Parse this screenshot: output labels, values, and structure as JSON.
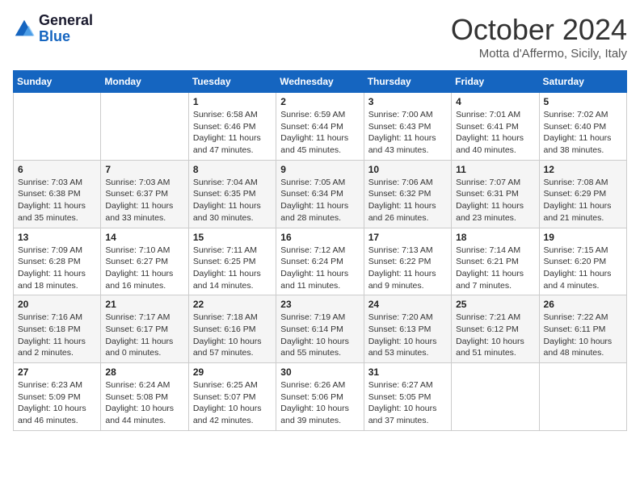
{
  "header": {
    "logo_general": "General",
    "logo_blue": "Blue",
    "month": "October 2024",
    "location": "Motta d'Affermo, Sicily, Italy"
  },
  "days_of_week": [
    "Sunday",
    "Monday",
    "Tuesday",
    "Wednesday",
    "Thursday",
    "Friday",
    "Saturday"
  ],
  "weeks": [
    [
      {
        "day": "",
        "sunrise": "",
        "sunset": "",
        "daylight": ""
      },
      {
        "day": "",
        "sunrise": "",
        "sunset": "",
        "daylight": ""
      },
      {
        "day": "1",
        "sunrise": "Sunrise: 6:58 AM",
        "sunset": "Sunset: 6:46 PM",
        "daylight": "Daylight: 11 hours and 47 minutes."
      },
      {
        "day": "2",
        "sunrise": "Sunrise: 6:59 AM",
        "sunset": "Sunset: 6:44 PM",
        "daylight": "Daylight: 11 hours and 45 minutes."
      },
      {
        "day": "3",
        "sunrise": "Sunrise: 7:00 AM",
        "sunset": "Sunset: 6:43 PM",
        "daylight": "Daylight: 11 hours and 43 minutes."
      },
      {
        "day": "4",
        "sunrise": "Sunrise: 7:01 AM",
        "sunset": "Sunset: 6:41 PM",
        "daylight": "Daylight: 11 hours and 40 minutes."
      },
      {
        "day": "5",
        "sunrise": "Sunrise: 7:02 AM",
        "sunset": "Sunset: 6:40 PM",
        "daylight": "Daylight: 11 hours and 38 minutes."
      }
    ],
    [
      {
        "day": "6",
        "sunrise": "Sunrise: 7:03 AM",
        "sunset": "Sunset: 6:38 PM",
        "daylight": "Daylight: 11 hours and 35 minutes."
      },
      {
        "day": "7",
        "sunrise": "Sunrise: 7:03 AM",
        "sunset": "Sunset: 6:37 PM",
        "daylight": "Daylight: 11 hours and 33 minutes."
      },
      {
        "day": "8",
        "sunrise": "Sunrise: 7:04 AM",
        "sunset": "Sunset: 6:35 PM",
        "daylight": "Daylight: 11 hours and 30 minutes."
      },
      {
        "day": "9",
        "sunrise": "Sunrise: 7:05 AM",
        "sunset": "Sunset: 6:34 PM",
        "daylight": "Daylight: 11 hours and 28 minutes."
      },
      {
        "day": "10",
        "sunrise": "Sunrise: 7:06 AM",
        "sunset": "Sunset: 6:32 PM",
        "daylight": "Daylight: 11 hours and 26 minutes."
      },
      {
        "day": "11",
        "sunrise": "Sunrise: 7:07 AM",
        "sunset": "Sunset: 6:31 PM",
        "daylight": "Daylight: 11 hours and 23 minutes."
      },
      {
        "day": "12",
        "sunrise": "Sunrise: 7:08 AM",
        "sunset": "Sunset: 6:29 PM",
        "daylight": "Daylight: 11 hours and 21 minutes."
      }
    ],
    [
      {
        "day": "13",
        "sunrise": "Sunrise: 7:09 AM",
        "sunset": "Sunset: 6:28 PM",
        "daylight": "Daylight: 11 hours and 18 minutes."
      },
      {
        "day": "14",
        "sunrise": "Sunrise: 7:10 AM",
        "sunset": "Sunset: 6:27 PM",
        "daylight": "Daylight: 11 hours and 16 minutes."
      },
      {
        "day": "15",
        "sunrise": "Sunrise: 7:11 AM",
        "sunset": "Sunset: 6:25 PM",
        "daylight": "Daylight: 11 hours and 14 minutes."
      },
      {
        "day": "16",
        "sunrise": "Sunrise: 7:12 AM",
        "sunset": "Sunset: 6:24 PM",
        "daylight": "Daylight: 11 hours and 11 minutes."
      },
      {
        "day": "17",
        "sunrise": "Sunrise: 7:13 AM",
        "sunset": "Sunset: 6:22 PM",
        "daylight": "Daylight: 11 hours and 9 minutes."
      },
      {
        "day": "18",
        "sunrise": "Sunrise: 7:14 AM",
        "sunset": "Sunset: 6:21 PM",
        "daylight": "Daylight: 11 hours and 7 minutes."
      },
      {
        "day": "19",
        "sunrise": "Sunrise: 7:15 AM",
        "sunset": "Sunset: 6:20 PM",
        "daylight": "Daylight: 11 hours and 4 minutes."
      }
    ],
    [
      {
        "day": "20",
        "sunrise": "Sunrise: 7:16 AM",
        "sunset": "Sunset: 6:18 PM",
        "daylight": "Daylight: 11 hours and 2 minutes."
      },
      {
        "day": "21",
        "sunrise": "Sunrise: 7:17 AM",
        "sunset": "Sunset: 6:17 PM",
        "daylight": "Daylight: 11 hours and 0 minutes."
      },
      {
        "day": "22",
        "sunrise": "Sunrise: 7:18 AM",
        "sunset": "Sunset: 6:16 PM",
        "daylight": "Daylight: 10 hours and 57 minutes."
      },
      {
        "day": "23",
        "sunrise": "Sunrise: 7:19 AM",
        "sunset": "Sunset: 6:14 PM",
        "daylight": "Daylight: 10 hours and 55 minutes."
      },
      {
        "day": "24",
        "sunrise": "Sunrise: 7:20 AM",
        "sunset": "Sunset: 6:13 PM",
        "daylight": "Daylight: 10 hours and 53 minutes."
      },
      {
        "day": "25",
        "sunrise": "Sunrise: 7:21 AM",
        "sunset": "Sunset: 6:12 PM",
        "daylight": "Daylight: 10 hours and 51 minutes."
      },
      {
        "day": "26",
        "sunrise": "Sunrise: 7:22 AM",
        "sunset": "Sunset: 6:11 PM",
        "daylight": "Daylight: 10 hours and 48 minutes."
      }
    ],
    [
      {
        "day": "27",
        "sunrise": "Sunrise: 6:23 AM",
        "sunset": "Sunset: 5:09 PM",
        "daylight": "Daylight: 10 hours and 46 minutes."
      },
      {
        "day": "28",
        "sunrise": "Sunrise: 6:24 AM",
        "sunset": "Sunset: 5:08 PM",
        "daylight": "Daylight: 10 hours and 44 minutes."
      },
      {
        "day": "29",
        "sunrise": "Sunrise: 6:25 AM",
        "sunset": "Sunset: 5:07 PM",
        "daylight": "Daylight: 10 hours and 42 minutes."
      },
      {
        "day": "30",
        "sunrise": "Sunrise: 6:26 AM",
        "sunset": "Sunset: 5:06 PM",
        "daylight": "Daylight: 10 hours and 39 minutes."
      },
      {
        "day": "31",
        "sunrise": "Sunrise: 6:27 AM",
        "sunset": "Sunset: 5:05 PM",
        "daylight": "Daylight: 10 hours and 37 minutes."
      },
      {
        "day": "",
        "sunrise": "",
        "sunset": "",
        "daylight": ""
      },
      {
        "day": "",
        "sunrise": "",
        "sunset": "",
        "daylight": ""
      }
    ]
  ]
}
